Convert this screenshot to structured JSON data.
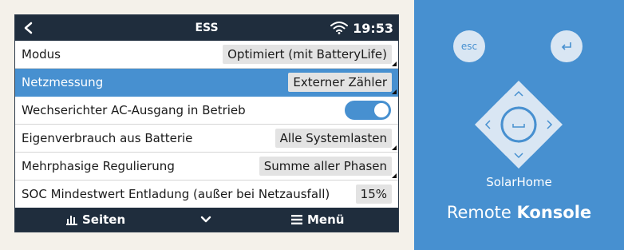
{
  "header": {
    "title": "ESS",
    "time": "19:53"
  },
  "settings": [
    {
      "label": "Modus",
      "value": "Optimiert (mit BatteryLife)"
    },
    {
      "label": "Netzmessung",
      "value": "Externer Zähler",
      "selected": true
    },
    {
      "label": "Wechserichter AC-Ausgang in Betrieb",
      "toggle": "on"
    },
    {
      "label": "Eigenverbrauch aus Batterie",
      "value": "Alle Systemlasten"
    },
    {
      "label": "Mehrphasige Regulierung",
      "value": "Summe aller Phasen"
    },
    {
      "label": "SOC Mindestwert Entladung (außer bei Netzausfall)",
      "value": "15%"
    }
  ],
  "footer": {
    "pages_label": "Seiten",
    "menu_label": "Menü"
  },
  "remote": {
    "esc_label": "esc",
    "site_name": "SolarHome",
    "title_regular": "Remote ",
    "title_bold": "Konsole"
  },
  "colors": {
    "accent": "#4790d0",
    "bar": "#1f2d3d"
  },
  "icons": [
    "back-arrow-icon",
    "wifi-icon",
    "bar-chart-icon",
    "chevron-down-icon",
    "hamburger-menu-icon",
    "enter-icon",
    "space-icon"
  ]
}
